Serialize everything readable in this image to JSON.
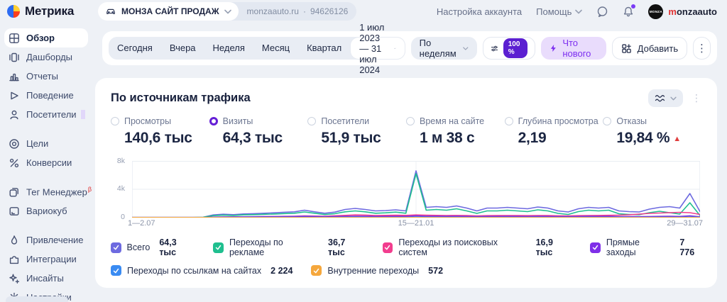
{
  "brand": {
    "app_name": "Метрика",
    "avatar_text": "MONZA",
    "account_first": "m",
    "account_rest": "onzaauto"
  },
  "header": {
    "counter": {
      "name": "МОНЗА САЙТ ПРОДАЖ",
      "domain": "monzaauto.ru",
      "separator": "·",
      "id": "94626126"
    },
    "links": {
      "account_settings": "Настройка аккаунта",
      "help": "Помощь"
    }
  },
  "sidebar": {
    "groups": [
      {
        "items": [
          {
            "label": "Обзор",
            "selected": true
          },
          {
            "label": "Дашборды"
          },
          {
            "label": "Отчеты"
          },
          {
            "label": "Поведение"
          },
          {
            "label": "Посетители",
            "badge": true
          }
        ]
      },
      {
        "items": [
          {
            "label": "Цели"
          },
          {
            "label": "Конверсии"
          }
        ]
      },
      {
        "items": [
          {
            "label": "Тег Менеджер",
            "beta": "β"
          },
          {
            "label": "Вариокуб"
          }
        ]
      },
      {
        "items": [
          {
            "label": "Привлечение"
          },
          {
            "label": "Интеграции"
          },
          {
            "label": "Инсайты"
          },
          {
            "label": "Настройки"
          }
        ]
      }
    ]
  },
  "toolbar": {
    "quick_ranges": [
      "Сегодня",
      "Вчера",
      "Неделя",
      "Месяц",
      "Квартал"
    ],
    "date_range": "1 июл 2023 — 31 июл 2024",
    "granularity": "По неделям",
    "sampling": "100 %",
    "whats_new": "Что нового",
    "add": "Добавить",
    "kebab": "⋮"
  },
  "card": {
    "title": "По источникам трафика",
    "kebab": "⋮",
    "metrics": [
      {
        "label": "Просмотры",
        "value": "140,6 тыс",
        "selected": false
      },
      {
        "label": "Визиты",
        "value": "64,3 тыс",
        "selected": true
      },
      {
        "label": "Посетители",
        "value": "51,9 тыс",
        "selected": false
      },
      {
        "label": "Время на сайте",
        "value": "1 м 38 с",
        "selected": false
      },
      {
        "label": "Глубина просмотра",
        "value": "2,19",
        "selected": false
      },
      {
        "label": "Отказы",
        "value": "19,84 %",
        "selected": false,
        "trend": "▲"
      }
    ]
  },
  "chart_data": {
    "type": "line",
    "title": "По источникам трафика",
    "ylim": [
      0,
      8000
    ],
    "y_ticks": [
      "8k",
      "4k",
      "0"
    ],
    "x_ticks": [
      {
        "index": 0,
        "label": "1—2.07"
      },
      {
        "index": 28,
        "label": "15—21.01"
      },
      {
        "index": 56,
        "label": "29—31.07"
      }
    ],
    "grid": true,
    "legend_position": "bottom",
    "series": [
      {
        "name": "Всего",
        "total": "64,3 тыс",
        "color": "#6d6ae0",
        "values": [
          40,
          40,
          40,
          40,
          40,
          40,
          40,
          60,
          380,
          480,
          420,
          520,
          560,
          620,
          680,
          760,
          820,
          1050,
          820,
          620,
          780,
          1150,
          1300,
          1150,
          950,
          1000,
          1100,
          950,
          6600,
          1450,
          1550,
          1450,
          1650,
          1350,
          950,
          1350,
          1350,
          1450,
          1350,
          1250,
          1500,
          1350,
          950,
          800,
          1250,
          1450,
          1350,
          1450,
          950,
          850,
          800,
          1200,
          1450,
          1550,
          1350,
          3400,
          850
        ]
      },
      {
        "name": "Переходы по рекламе",
        "total": "36,7 тыс",
        "color": "#1fbf8f",
        "values": [
          20,
          20,
          20,
          20,
          20,
          20,
          20,
          40,
          280,
          360,
          310,
          390,
          420,
          470,
          510,
          570,
          620,
          800,
          620,
          440,
          560,
          820,
          950,
          820,
          620,
          680,
          780,
          620,
          6200,
          1050,
          1150,
          1050,
          1250,
          950,
          600,
          950,
          950,
          1050,
          950,
          850,
          1100,
          950,
          600,
          450,
          850,
          1050,
          950,
          1050,
          550,
          450,
          420,
          700,
          900,
          700,
          500,
          2100,
          300
        ]
      },
      {
        "name": "Переходы из поисковых систем",
        "total": "16,9 тыс",
        "color": "#f23d8e",
        "values": [
          10,
          10,
          10,
          10,
          10,
          10,
          10,
          10,
          60,
          90,
          100,
          110,
          120,
          140,
          160,
          180,
          200,
          240,
          220,
          200,
          260,
          320,
          380,
          360,
          300,
          320,
          340,
          320,
          380,
          340,
          320,
          300,
          310,
          290,
          250,
          280,
          290,
          300,
          290,
          280,
          300,
          290,
          260,
          250,
          280,
          300,
          310,
          330,
          350,
          400,
          500,
          600,
          650,
          700,
          750,
          700,
          450
        ]
      },
      {
        "name": "Прямые заходы",
        "total": "7 776",
        "color": "#7f2fe8",
        "values": [
          5,
          5,
          5,
          5,
          5,
          5,
          5,
          5,
          80,
          100,
          110,
          120,
          130,
          140,
          150,
          160,
          170,
          190,
          170,
          150,
          160,
          180,
          200,
          190,
          170,
          170,
          180,
          170,
          260,
          200,
          190,
          180,
          190,
          170,
          150,
          170,
          170,
          180,
          170,
          160,
          180,
          170,
          150,
          140,
          160,
          180,
          170,
          180,
          150,
          140,
          140,
          160,
          180,
          190,
          170,
          260,
          120
        ]
      },
      {
        "name": "Переходы по ссылкам на сайтах",
        "total": "2 224",
        "color": "#3a8bf2",
        "values": [
          2,
          2,
          2,
          2,
          2,
          2,
          2,
          2,
          30,
          40,
          40,
          45,
          45,
          50,
          50,
          55,
          55,
          60,
          55,
          50,
          55,
          60,
          65,
          60,
          55,
          55,
          60,
          55,
          90,
          65,
          60,
          60,
          60,
          55,
          50,
          55,
          55,
          60,
          55,
          55,
          60,
          55,
          50,
          45,
          55,
          60,
          55,
          60,
          50,
          45,
          45,
          55,
          60,
          60,
          55,
          90,
          40
        ]
      },
      {
        "name": "Внутренние переходы",
        "total": "572",
        "color": "#f5a73c",
        "values": [
          15,
          15,
          15,
          15,
          15,
          15,
          15,
          15,
          12,
          12,
          12,
          12,
          12,
          12,
          12,
          12,
          12,
          12,
          12,
          12,
          12,
          12,
          12,
          12,
          12,
          12,
          12,
          12,
          20,
          12,
          12,
          12,
          12,
          12,
          12,
          12,
          12,
          12,
          12,
          12,
          12,
          12,
          12,
          12,
          12,
          12,
          12,
          12,
          12,
          12,
          12,
          12,
          12,
          12,
          12,
          20,
          10
        ]
      }
    ]
  }
}
